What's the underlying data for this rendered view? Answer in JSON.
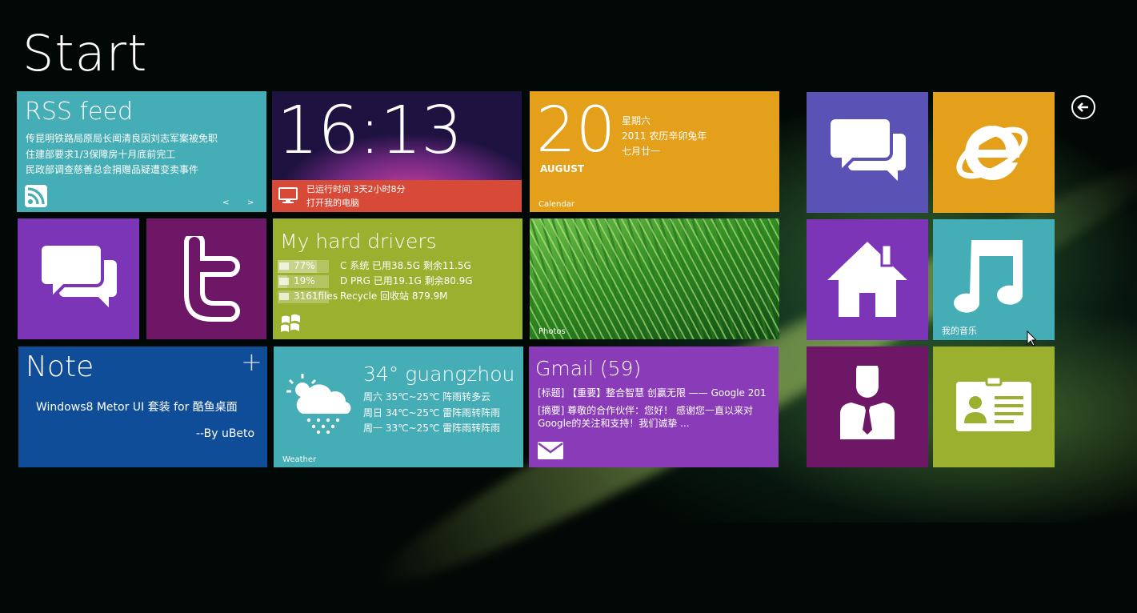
{
  "page": {
    "title": "Start"
  },
  "rss": {
    "title": "RSS feed",
    "lines": [
      "传昆明铁路局原局长闻清良因刘志军案被免职",
      "住建部要求1/3保障房十月底前完工",
      "民政部调查慈善总会捐赠品疑遭变卖事件"
    ],
    "prev": "<",
    "next": ">"
  },
  "clock": {
    "time": "16:13",
    "uptime": "已运行时间 3天2小时8分",
    "open": "打开我的电脑"
  },
  "calendar": {
    "day": "20",
    "month": "AUGUST",
    "weekday": "星期六",
    "lunar_year": "2011 农历辛卯兔年",
    "lunar_day": "七月廿一",
    "label": "Calendar"
  },
  "drives": {
    "title": "My hard drivers",
    "rows": [
      {
        "badge": "77%",
        "text": "C 系统 已用38.5G 剩余11.5G",
        "fill": 0.77
      },
      {
        "badge": "19%",
        "text": "D PRG 已用19.1G 剩余80.9G",
        "fill": 0.19
      },
      {
        "badge": "3161files",
        "text": "Recycle 回收站 879.9M",
        "fill": 0
      }
    ]
  },
  "photos": {
    "label": "Photos"
  },
  "note": {
    "title": "Note",
    "body": "Windows8 Metor UI 套装 for 酷鱼桌面",
    "sign": "--By uBeto",
    "plus": "+"
  },
  "weather": {
    "title": "34° guangzhou",
    "days": [
      "周六 35℃~25℃ 阵雨转多云",
      "周日 34℃~25℃ 雷阵雨转阵雨",
      "周一 33℃~25℃ 雷阵雨转阵雨"
    ],
    "label": "Weather"
  },
  "gmail": {
    "title": "Gmail (59)",
    "line1": "[标题] 【重要】整合智慧 创赢无限 —— Google 201",
    "line2": "[摘要] 尊敬的合作伙伴：您好！ 感谢您一直以来对",
    "line3": "Google的关注和支持！我们诚挚 ..."
  },
  "music": {
    "label": "我的音乐"
  },
  "colors": {
    "teal": "#44adb5",
    "purple": "#7c35b6",
    "magenta": "#6e1766",
    "green": "#9bb02f",
    "orange": "#e4a01b",
    "blue": "#0f4d99",
    "indigo": "#5a53b5",
    "violet": "#8a3cb8",
    "red": "#d64a37"
  }
}
